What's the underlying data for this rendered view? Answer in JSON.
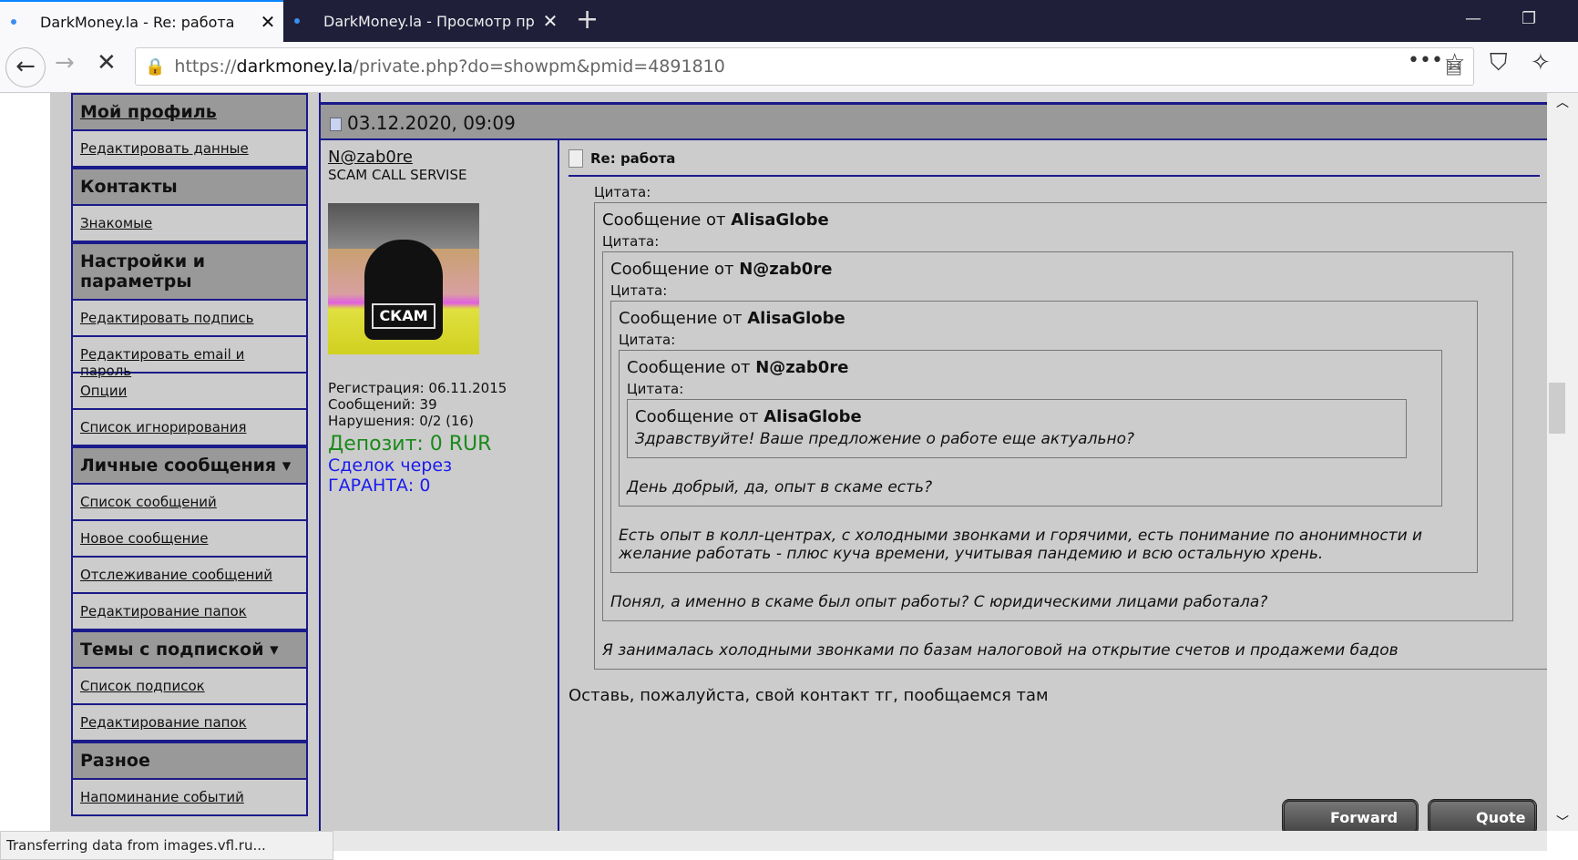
{
  "browser": {
    "tabs": [
      {
        "title": "DarkMoney.la - Re: работа",
        "active": true
      },
      {
        "title": "DarkMoney.la - Просмотр про",
        "active": false
      }
    ],
    "url_prefix": "https://",
    "url_domain": "darkmoney.la",
    "url_path": "/private.php?do=showpm&pmid=4891810",
    "status": "Transferring data from images.vfl.ru..."
  },
  "sidebar": [
    {
      "type": "header",
      "label": "Мой профиль",
      "link": true
    },
    {
      "type": "link",
      "label": "Редактировать данные"
    },
    {
      "type": "header",
      "label": "Контакты"
    },
    {
      "type": "link",
      "label": "Знакомые"
    },
    {
      "type": "header",
      "label": "Настройки и параметры"
    },
    {
      "type": "link",
      "label": "Редактировать подпись"
    },
    {
      "type": "link",
      "label": "Редактировать email и пароль"
    },
    {
      "type": "link",
      "label": "Опции"
    },
    {
      "type": "link",
      "label": "Список игнорирования"
    },
    {
      "type": "header",
      "label": "Личные сообщения ▾"
    },
    {
      "type": "link",
      "label": "Список сообщений"
    },
    {
      "type": "link",
      "label": "Новое сообщение"
    },
    {
      "type": "link",
      "label": "Отслеживание сообщений"
    },
    {
      "type": "link",
      "label": "Редактирование папок"
    },
    {
      "type": "header",
      "label": "Темы с подпиской ▾"
    },
    {
      "type": "link",
      "label": "Список подписок"
    },
    {
      "type": "link",
      "label": "Редактирование папок"
    },
    {
      "type": "header",
      "label": "Разное"
    },
    {
      "type": "link",
      "label": "Напоминание событий"
    }
  ],
  "post": {
    "date": "03.12.2020, 09:09",
    "author": "N@zab0re",
    "user_title": "SCAM CALL SERVISE",
    "avatar_text": "СКАМ",
    "registration": "Регистрация: 06.11.2015",
    "messages": "Сообщений: 39",
    "violations": "Нарушения: 0/2 (16)",
    "deposit": "Депозит: 0 RUR",
    "deals1": "Сделок через",
    "deals2": "ГАРАНТА: 0",
    "title": "Re: работа",
    "quote_label": "Цитата:",
    "from_label": "Сообщение от ",
    "quotes": [
      {
        "author": "AlisaGlobe",
        "text": "Я занималась холодными звонками по базам налоговой на открытие счетов и продажеми бадов"
      },
      {
        "author": "N@zab0re",
        "text": "Понял, а именно в скаме был опыт работы? С юридическими лицами работала?"
      },
      {
        "author": "AlisaGlobe",
        "text": "Есть опыт в колл-центрах, с холодными звонками и горячими, есть понимание по анонимности и желание работать - плюс куча времени, учитывая пандемию и всю остальную хрень."
      },
      {
        "author": "N@zab0re",
        "text": "День добрый, да, опыт в скаме есть?"
      },
      {
        "author": "AlisaGlobe",
        "text": "Здравствуйте! Ваше предложение о работе еще актуально?"
      }
    ],
    "reply": "Оставь, пожалуйста, свой контакт тг, пообщаемся там",
    "forward": "Forward",
    "quote": "Quote"
  }
}
